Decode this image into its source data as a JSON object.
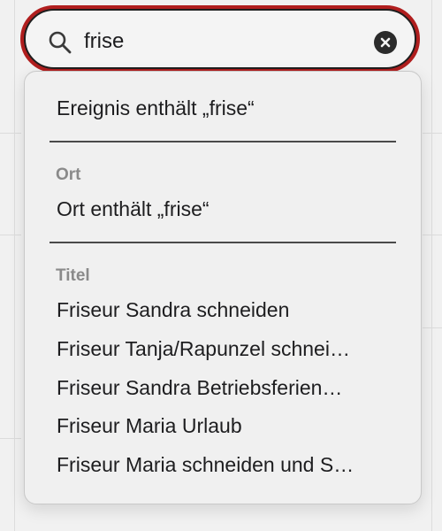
{
  "search": {
    "value": "frise",
    "placeholder": ""
  },
  "dropdown": {
    "event_item": "Ereignis enthält „frise“",
    "location_section": {
      "label": "Ort",
      "item": "Ort enthält „frise“"
    },
    "title_section": {
      "label": "Titel",
      "items": [
        "Friseur Sandra schneiden",
        "Friseur Tanja/Rapunzel schnei…",
        "Friseur Sandra Betriebsferien…",
        "Friseur Maria Urlaub",
        "Friseur Maria schneiden und S…"
      ]
    }
  },
  "colors": {
    "focus_ring": "#b01e1e",
    "section_label": "#8a8a8a",
    "background": "#f1f1f1"
  },
  "icons": {
    "search": "magnifying-glass-icon",
    "clear": "clear-circle-x-icon"
  }
}
